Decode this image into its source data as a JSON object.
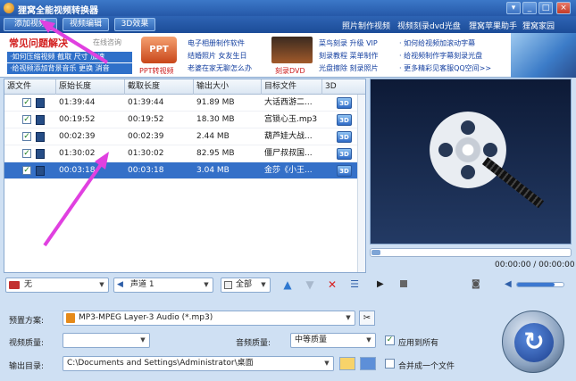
{
  "window": {
    "title": "狸窝全能视频转换器"
  },
  "toolbar": {
    "add_video": "添加视频",
    "edit_video": "视频编辑",
    "effect_3d": "3D效果",
    "links": [
      "照片制作视频",
      "视频刻录dvd光盘",
      "狸窝苹果助手",
      "狸窝家园"
    ]
  },
  "banner": {
    "faq_title": "常见问题解决",
    "faq_online": "在线咨询",
    "faq_rows": [
      "·如何压缩视频 截取 尺寸 加速",
      "·给视频添加背景音乐 更换 消音"
    ],
    "ppt_label": "PPT转视频",
    "ppt_badge": "PPT",
    "col1": [
      "电子相册制作软件",
      "结婚照片 女友生日",
      "老婆在家无聊怎么办"
    ],
    "dvd_label": "刻录DVD",
    "col2": [
      "菜鸟刻录 升级 VIP",
      "刻录教程 菜单制作",
      "光盘擦除 刻录照片"
    ],
    "col3": [
      "· 如何给视频加滚动字幕",
      "· 给视频制作字幕刻录光盘",
      "· 更多精彩见客服QQ空间>>"
    ]
  },
  "filelist": {
    "columns": [
      "源文件",
      "原始长度",
      "截取长度",
      "输出大小",
      "目标文件",
      "3D"
    ],
    "rows": [
      {
        "original": "01:39:44",
        "clip": "01:39:44",
        "size": "91.89 MB",
        "target": "大话西游二...",
        "d3": "3D"
      },
      {
        "original": "00:19:52",
        "clip": "00:19:52",
        "size": "18.30 MB",
        "target": "宫锁心玉.mp3",
        "d3": "3D"
      },
      {
        "original": "00:02:39",
        "clip": "00:02:39",
        "size": "2.44 MB",
        "target": "葫芦娃大战...",
        "d3": "3D"
      },
      {
        "original": "01:30:02",
        "clip": "01:30:02",
        "size": "82.95 MB",
        "target": "僵尸叔叔国...",
        "d3": "3D"
      },
      {
        "original": "00:03:18",
        "clip": "00:03:18",
        "size": "3.04 MB",
        "target": "金莎《小王...",
        "d3": "3D"
      }
    ],
    "selected_row": 4
  },
  "list_toolbar": {
    "subtitle": "无",
    "audio_track": "声道 1",
    "select_mode": "全部"
  },
  "preview": {
    "time": "00:00:00 / 00:00:00"
  },
  "settings": {
    "preset_label": "预置方案:",
    "preset_value": "MP3-MPEG Layer-3 Audio (*.mp3)",
    "video_quality_label": "视频质量:",
    "video_quality_value": "",
    "audio_quality_label": "音频质量:",
    "audio_quality_value": "中等质量",
    "apply_all": "应用到所有",
    "output_label": "输出目录:",
    "output_path": "C:\\Documents and Settings\\Administrator\\桌面",
    "merge": "合并成一个文件"
  },
  "colors": {
    "accent": "#2f70c9",
    "selection": "#3470c8",
    "annotation": "#e040e0"
  }
}
